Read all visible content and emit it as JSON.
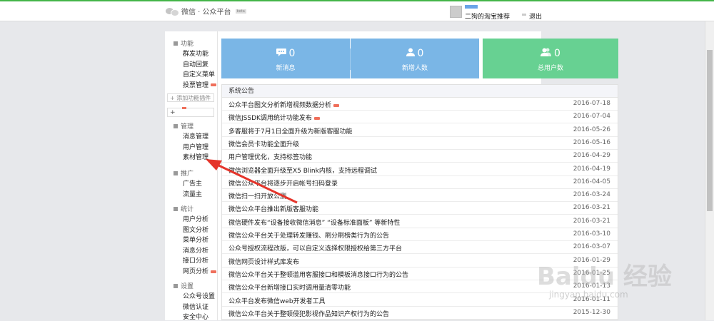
{
  "header": {
    "logo_text": "微信 · 公众平台",
    "beta_label": "beta",
    "username": "二狗的淘宝推荐",
    "logout": "退出"
  },
  "sidebar": {
    "sections": [
      {
        "title": "功能",
        "items": [
          {
            "label": "群发功能",
            "new": false
          },
          {
            "label": "自动回复",
            "new": false
          },
          {
            "label": "自定义菜单",
            "new": false
          },
          {
            "label": "投票管理",
            "new": true
          }
        ]
      },
      {
        "title": "管理",
        "items": [
          {
            "label": "消息管理",
            "new": false
          },
          {
            "label": "用户管理",
            "new": false
          },
          {
            "label": "素材管理",
            "new": false
          }
        ]
      },
      {
        "title": "推广",
        "items": [
          {
            "label": "广告主",
            "new": false
          },
          {
            "label": "流量主",
            "new": false
          }
        ]
      },
      {
        "title": "统计",
        "items": [
          {
            "label": "用户分析",
            "new": false
          },
          {
            "label": "图文分析",
            "new": false
          },
          {
            "label": "菜单分析",
            "new": false
          },
          {
            "label": "消息分析",
            "new": false
          },
          {
            "label": "接口分析",
            "new": false
          },
          {
            "label": "网页分析",
            "new": true
          }
        ]
      },
      {
        "title": "设置",
        "items": [
          {
            "label": "公众号设置",
            "new": false
          },
          {
            "label": "微信认证",
            "new": false
          },
          {
            "label": "安全中心",
            "new": false
          }
        ]
      }
    ],
    "add_plugin": "+ 添加功能插件",
    "plus": "+"
  },
  "stats": {
    "new_messages": {
      "value": "0",
      "label": "新消息",
      "color": "#7ab6e6"
    },
    "new_users": {
      "value": "0",
      "label": "新增人数",
      "color": "#7ab6e6"
    },
    "total_users": {
      "value": "0",
      "label": "总用户数",
      "color": "#67d192"
    }
  },
  "announcements": {
    "header": "系统公告",
    "rows": [
      {
        "title": "公众平台图文分析新增视频数据分析",
        "date": "2016-07-18",
        "new": true
      },
      {
        "title": "微信JSSDK调用统计功能发布",
        "date": "2016-07-04",
        "new": true
      },
      {
        "title": "多客服将于7月1日全面升级为新版客服功能",
        "date": "2016-05-26",
        "new": false
      },
      {
        "title": "微信会员卡功能全面升级",
        "date": "2016-05-16",
        "new": false
      },
      {
        "title": "用户管理优化，支持标签功能",
        "date": "2016-04-29",
        "new": false
      },
      {
        "title": "微信浏览器全面升级至X5 Blink内核，支持远程调试",
        "date": "2016-04-19",
        "new": false
      },
      {
        "title": "微信公众平台将逐步开启帐号扫码登录",
        "date": "2016-04-05",
        "new": false
      },
      {
        "title": "微信扫一扫开放公测",
        "date": "2016-03-24",
        "new": false
      },
      {
        "title": "微信公众平台推出新版客服功能",
        "date": "2016-03-21",
        "new": false
      },
      {
        "title": "微信硬件发布“设备接收微信消息” “设备标准面板” 等新特性",
        "date": "2016-03-21",
        "new": false
      },
      {
        "title": "微信公众平台关于处理转发赚钱、刷分刷榜类行为的公告",
        "date": "2016-03-10",
        "new": false
      },
      {
        "title": "公众号授权流程改版，可以自定义选择权限授权给第三方平台",
        "date": "2016-03-07",
        "new": false
      },
      {
        "title": "微信网页设计样式库发布",
        "date": "2016-01-29",
        "new": false
      },
      {
        "title": "微信公众平台关于整顿滥用客服接口和模板消息接口行为的公告",
        "date": "2016-01-25",
        "new": false
      },
      {
        "title": "微信公众平台新增接口实时调用量清零功能",
        "date": "2016-01-13",
        "new": false
      },
      {
        "title": "公众平台发布微信web开发者工具",
        "date": "2016-01-11",
        "new": false
      },
      {
        "title": "微信公众平台关于整顿侵犯影视作品知识产权行为的公告",
        "date": "2015-12-30",
        "new": false
      }
    ]
  },
  "watermark": {
    "text": "Baidu 经验",
    "sub": "jingyan.baidu.com"
  }
}
